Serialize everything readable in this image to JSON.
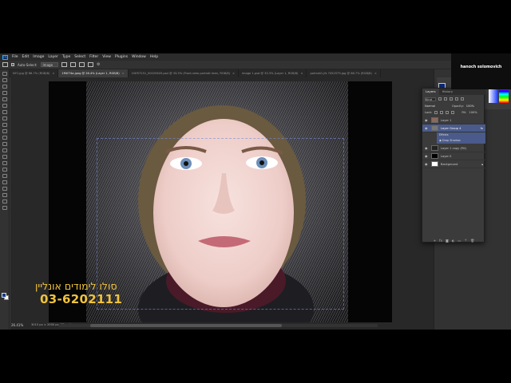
{
  "menu": {
    "items": [
      "File",
      "Edit",
      "Image",
      "Layer",
      "Type",
      "Select",
      "Filter",
      "View",
      "Plugins",
      "Window",
      "Help"
    ]
  },
  "options": {
    "auto_select_label": "Auto-Select:",
    "auto_select_value": "Image",
    "more_icon": "gear-icon"
  },
  "tabs": [
    {
      "label": "NY1.jpg @ 66.7% (RGB/8)",
      "active": false
    },
    {
      "label": "1ff4f74a.jpeg @ 26.4% (Layer 1, RGB/8)",
      "active": true
    },
    {
      "label": "1f4f57251_00029405.psd @ 33.3% (Front-view portrait teen, RGB/8)",
      "active": false
    },
    {
      "label": "image 1.psd @ 33.3% (Layer 1, RGB/8)",
      "active": false
    },
    {
      "label": "portrait1.jfs 7452579.jpg @ 66.7% (RGB/8)",
      "active": false
    }
  ],
  "status": {
    "zoom": "26.41%",
    "doc": "3015 px × 2000 px (72 ppi)"
  },
  "layers_panel": {
    "tab_layers": "Layers",
    "tab_history": "History",
    "kind_label": "Kind",
    "blend_mode": "Normal",
    "opacity_label": "Opacity:",
    "opacity_value": "100%",
    "lock_label": "Lock:",
    "fill_label": "Fill:",
    "fill_value": "100%",
    "layers": [
      {
        "name": "Layer 1",
        "selected": false,
        "thumb": "#8a6a5a"
      },
      {
        "name": "Layer Group 4",
        "selected": true,
        "thumb": "#777"
      },
      {
        "name": "Layer 1 copy (Fill)",
        "selected": false,
        "thumb": "#222"
      },
      {
        "name": "Layer 0",
        "selected": false,
        "thumb": "#000"
      },
      {
        "name": "Background",
        "selected": false,
        "thumb": "#fff"
      }
    ],
    "effects_label": "Effects",
    "drop_shadow_label": "Drop Shadow"
  },
  "webcam": {
    "name": "hanoch solomovich"
  },
  "promo": {
    "title": "סולו לימודים אונליין",
    "phone": "03-6202111"
  },
  "colors": {
    "accent": "#f0c33c",
    "selection": "#4a5a8a",
    "ps_blue": "#31a8ff"
  }
}
